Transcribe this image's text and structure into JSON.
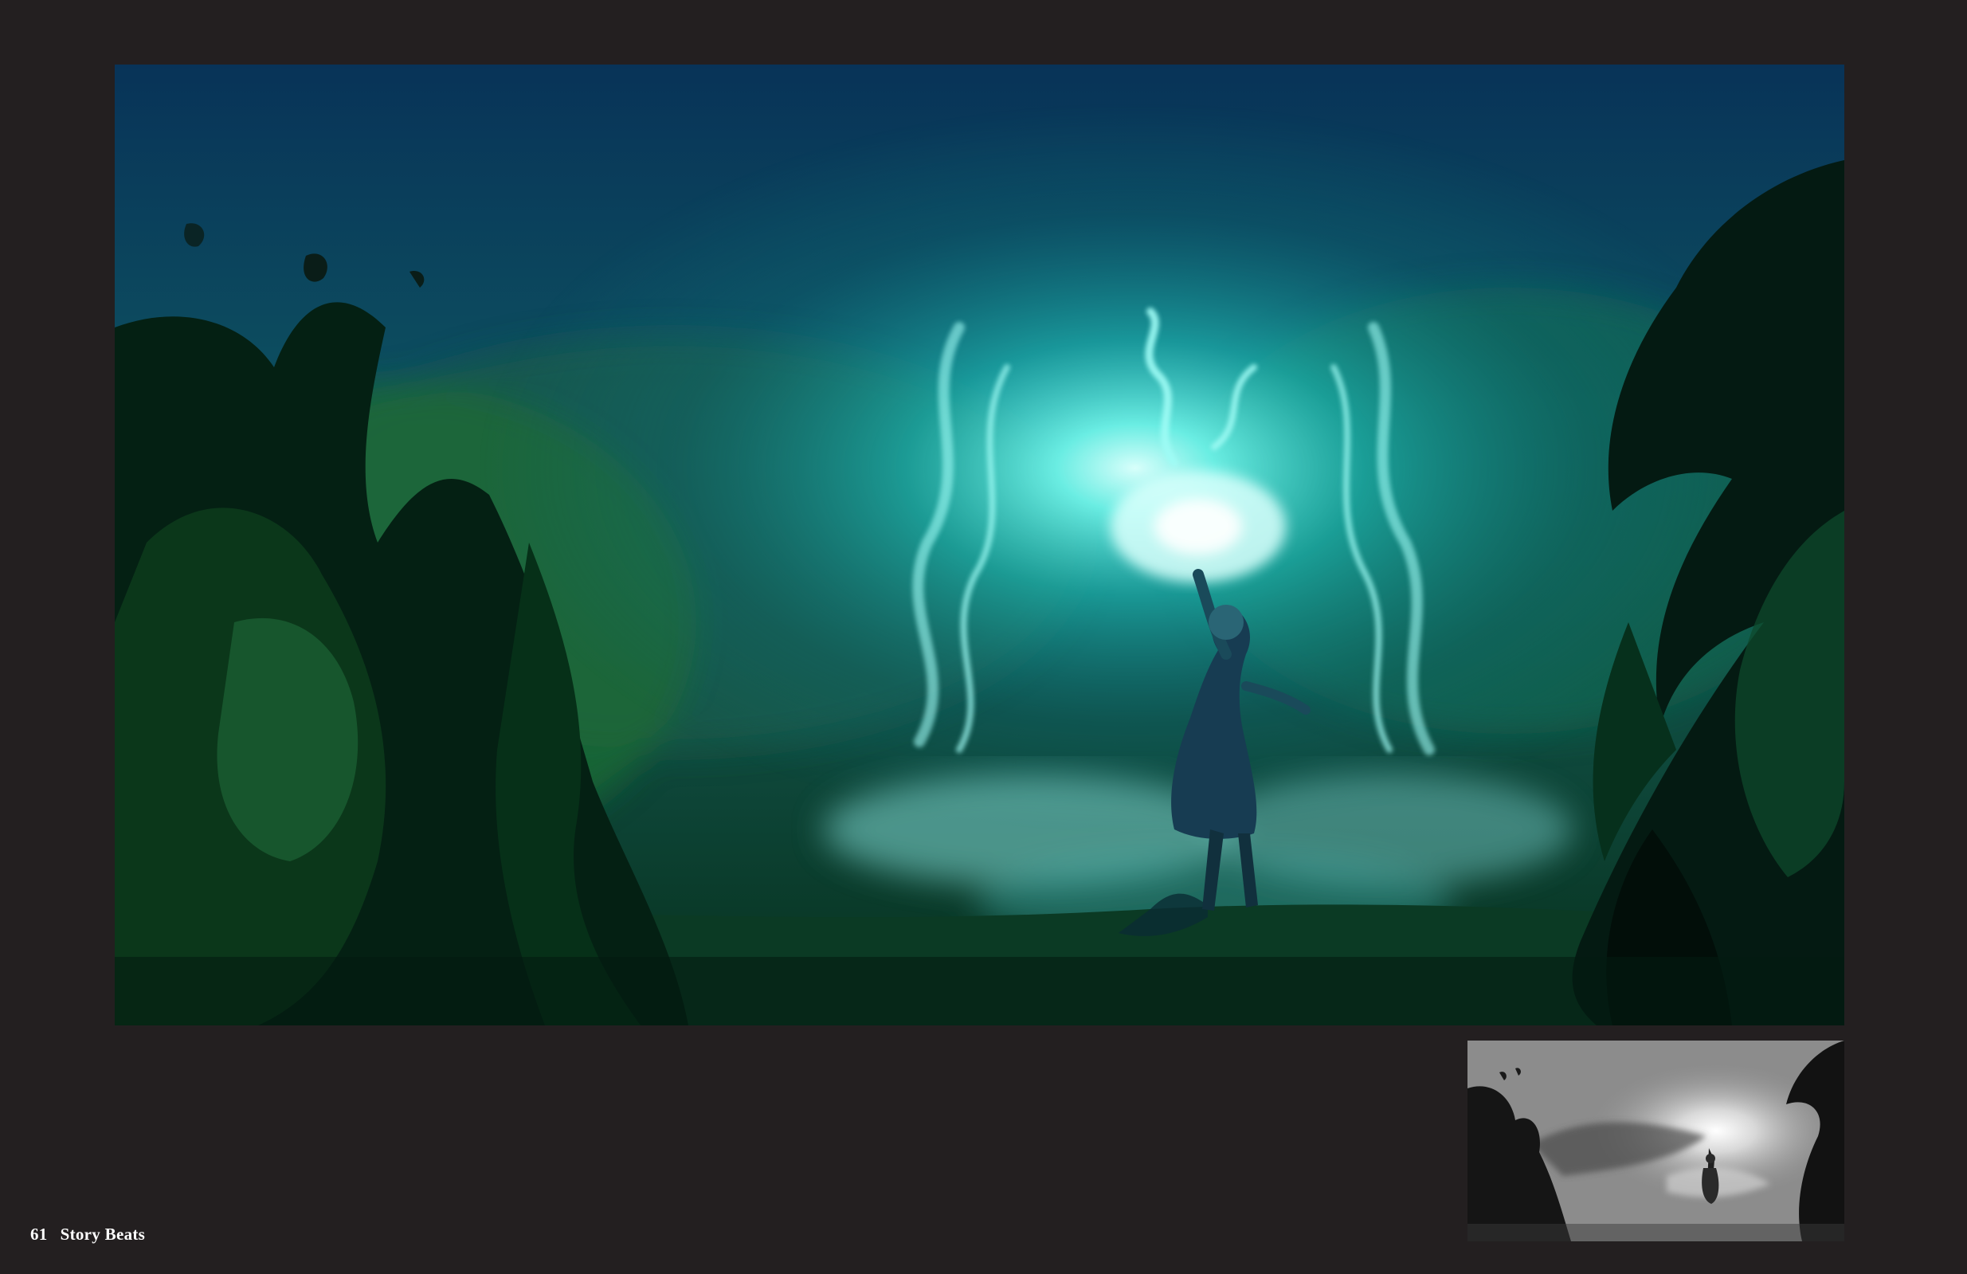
{
  "colors": {
    "page_background": "#231f20",
    "glow": "#6ff5ea",
    "fog": "#1f8f94",
    "foliage_dark": "#031a10",
    "foliage_green": "#1f6b3a",
    "sky": "#0b3c5a"
  },
  "footer": {
    "page_number": "61",
    "section_title": "Story Beats"
  }
}
